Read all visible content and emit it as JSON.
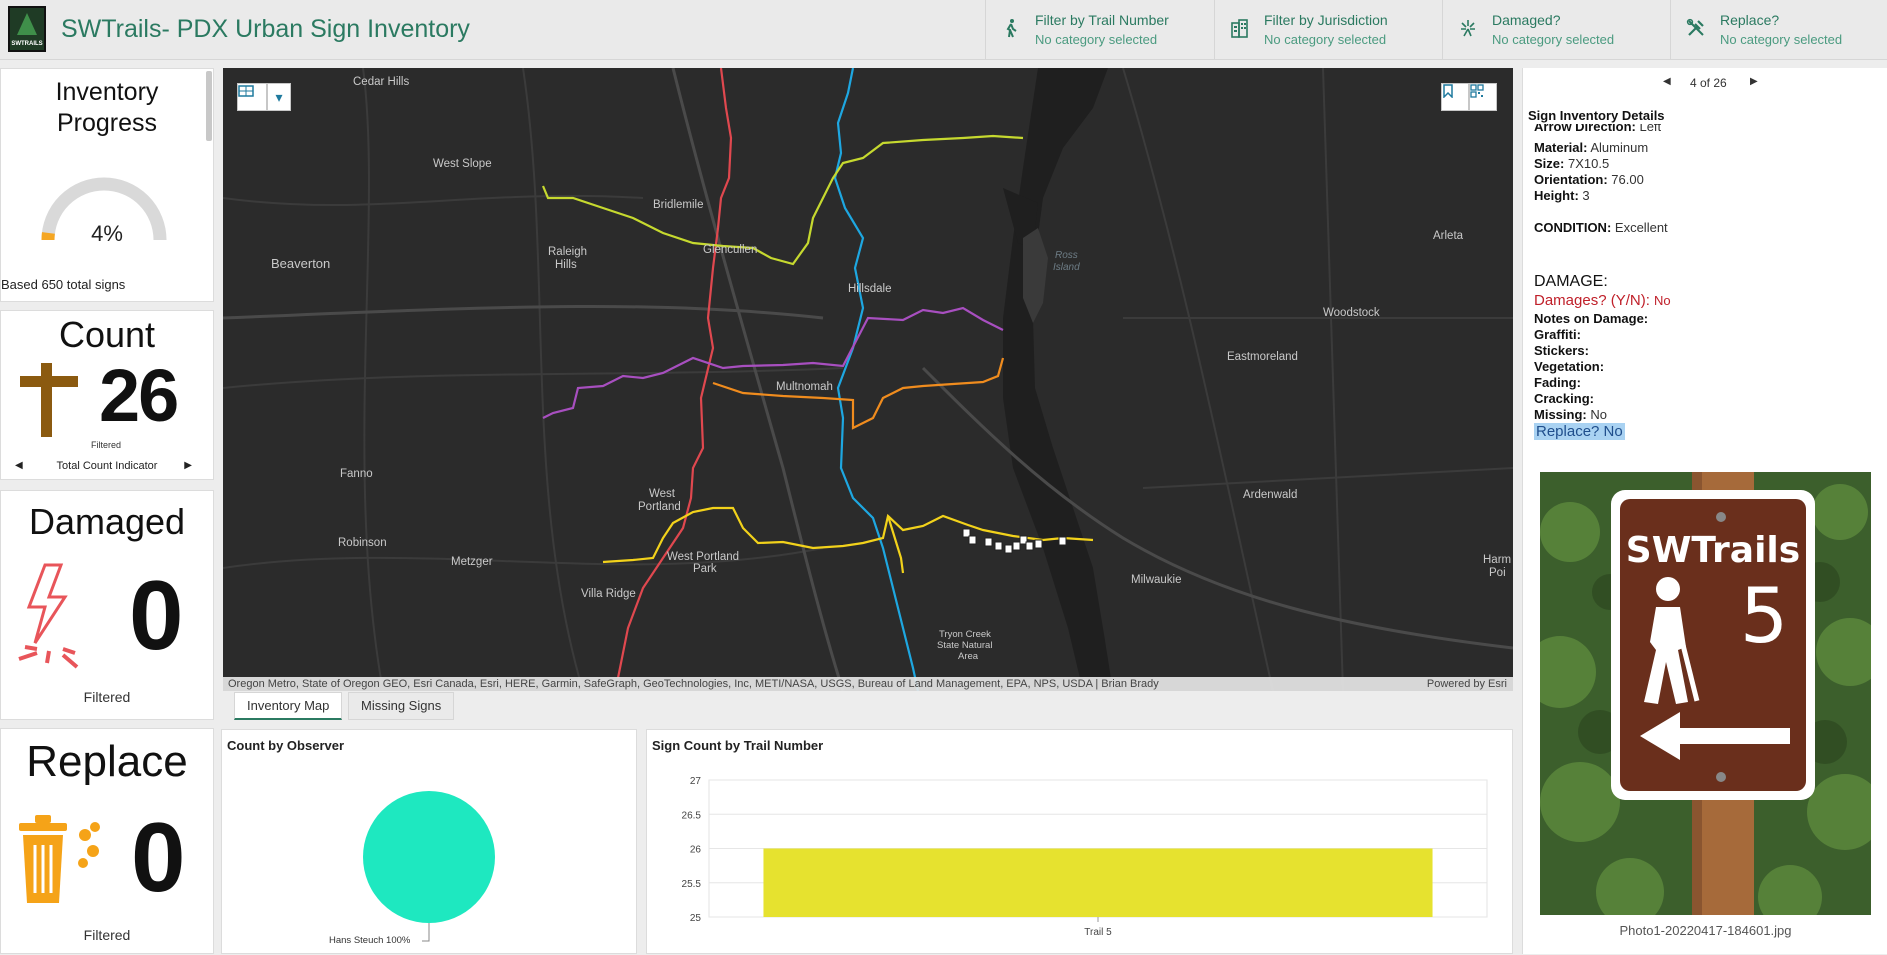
{
  "header": {
    "title": "SWTrails- PDX Urban Sign Inventory",
    "logo_text": "SWTRAILS",
    "filters": [
      {
        "label": "Filter by Trail Number",
        "value": "No category selected",
        "icon": "hiker-icon"
      },
      {
        "label": "Filter by Jurisdiction",
        "value": "No category selected",
        "icon": "building-icon"
      },
      {
        "label": "Damaged?",
        "value": "No category selected",
        "icon": "spark-icon"
      },
      {
        "label": "Replace?",
        "value": "No category selected",
        "icon": "tools-icon"
      }
    ]
  },
  "gauge": {
    "title_line1": "Inventory",
    "title_line2": "Progress",
    "value_text": "4%",
    "fraction": 0.04,
    "footer": "Based 650 total signs",
    "track_color": "#d9d9d9",
    "fill_color": "#f5a623"
  },
  "count": {
    "title": "Count",
    "value": "26",
    "sublabel": "Filtered",
    "nav_label": "Total Count Indicator",
    "icon_color": "#8b5a10"
  },
  "damaged": {
    "title": "Damaged",
    "value": "0",
    "footer": "Filtered",
    "icon_color": "#e8555a"
  },
  "replace": {
    "title": "Replace",
    "value": "0",
    "footer": "Filtered",
    "icon_color": "#f5a318"
  },
  "map": {
    "labels": {
      "cedar_hills": "Cedar Hills",
      "west_slope": "West Slope",
      "bridlemile": "Bridlemile",
      "raleigh_hills_1": "Raleigh",
      "raleigh_hills_2": "Hills",
      "glencullen": "Glencullen",
      "beaverton": "Beaverton",
      "hillsdale": "Hillsdale",
      "arleta": "Arleta",
      "ross_island_1": "Ross",
      "ross_island_2": "Island",
      "woodstock": "Woodstock",
      "eastmoreland": "Eastmoreland",
      "multnomah": "Multnomah",
      "fanno": "Fanno",
      "robinson": "Robinson",
      "metzger": "Metzger",
      "west_portland_1": "West",
      "west_portland_2": "Portland",
      "west_portland_park_1": "West Portland",
      "west_portland_park_2": "Park",
      "villa_ridge": "Villa Ridge",
      "ardenwald": "Ardenwald",
      "milwaukie": "Milwaukie",
      "harmony_1": "Harm",
      "harmony_2": "Poi",
      "tryon_1": "Tryon Creek",
      "tryon_2": "State Natural",
      "tryon_3": "Area"
    },
    "attribution": "Oregon Metro, State of Oregon GEO, Esri Canada, Esri, HERE, Garmin, SafeGraph, GeoTechnologies, Inc, METI/NASA, USGS, Bureau of Land Management, EPA, NPS, USDA | Brian Brady",
    "powered_by": "Powered by Esri",
    "trail_colors": {
      "red": "#e0484f",
      "blue": "#1ea7e1",
      "yellowgreen": "#c6d92f",
      "purple": "#a84fc0",
      "orange": "#f08c1e",
      "yellow": "#f2d21b"
    }
  },
  "tabs": [
    {
      "label": "Inventory Map",
      "active": true
    },
    {
      "label": "Missing Signs",
      "active": false
    }
  ],
  "observer_chart": {
    "title": "Count by Observer",
    "slice_label": "Hans Steuch 100%",
    "color": "#1ee8c0"
  },
  "chart_data": {
    "type": "bar",
    "title": "Sign Count by Trail Number",
    "categories": [
      "Trail 5"
    ],
    "values": [
      26
    ],
    "ylim": [
      25,
      27
    ],
    "yticks": [
      "25",
      "25.5",
      "26",
      "26.5",
      "27"
    ],
    "xlabel": "",
    "ylabel": "",
    "grid": true,
    "color": "#e6e22f"
  },
  "details": {
    "pager_text": "4 of 26",
    "title": "Sign Inventory Details",
    "fields": [
      {
        "label": "Arrow Direction:",
        "value": "Left"
      },
      {
        "label": "Material:",
        "value": "Aluminum"
      },
      {
        "label": "Size:",
        "value": "7X10.5"
      },
      {
        "label": "Orientation:",
        "value": "76.00"
      },
      {
        "label": "Height:",
        "value": "3"
      }
    ],
    "condition_label": "CONDITION:",
    "condition_value": "Excellent",
    "damage_heading": "DAMAGE:",
    "damages_label": "Damages? (Y/N):",
    "damages_value": "No",
    "damage_fields": [
      {
        "label": "Notes on Damage:",
        "value": ""
      },
      {
        "label": "Graffiti:",
        "value": ""
      },
      {
        "label": "Stickers:",
        "value": ""
      },
      {
        "label": "Vegetation:",
        "value": ""
      },
      {
        "label": "Fading:",
        "value": ""
      },
      {
        "label": "Cracking:",
        "value": ""
      },
      {
        "label": "Missing:",
        "value": "No"
      }
    ],
    "replace_text": "Replace? No",
    "sign_line1": "SWTrails",
    "sign_number": "5",
    "photo_caption": "Photo1-20220417-184601.jpg"
  }
}
